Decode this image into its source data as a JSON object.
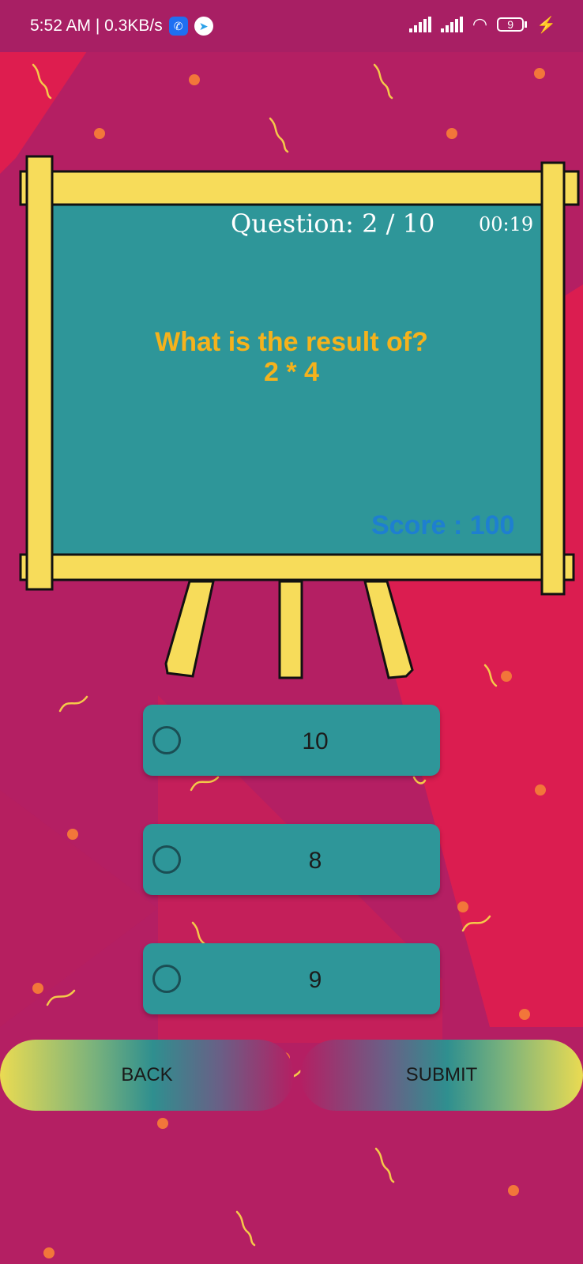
{
  "status_bar": {
    "time_speed": "5:52 AM | 0.3KB/s",
    "icons": [
      "phone-app-icon",
      "telegram-icon",
      "signal-icon",
      "signal-icon",
      "wifi-icon",
      "battery-icon",
      "charging-icon"
    ],
    "battery_level": "9"
  },
  "board": {
    "question_counter": "Question: 2 / 10",
    "timer": "00:19",
    "prompt_line1": "What is the result of?",
    "prompt_line2": "2 * 4",
    "score": "Score : 100"
  },
  "options": [
    {
      "label": "10"
    },
    {
      "label": "8"
    },
    {
      "label": "9"
    }
  ],
  "buttons": {
    "back": "BACK",
    "submit": "SUBMIT"
  },
  "colors": {
    "background": "#b41f63",
    "board": "#2e9699",
    "frame": "#f7dc5a",
    "prompt": "#f5b21c",
    "score": "#1e7fd0"
  }
}
